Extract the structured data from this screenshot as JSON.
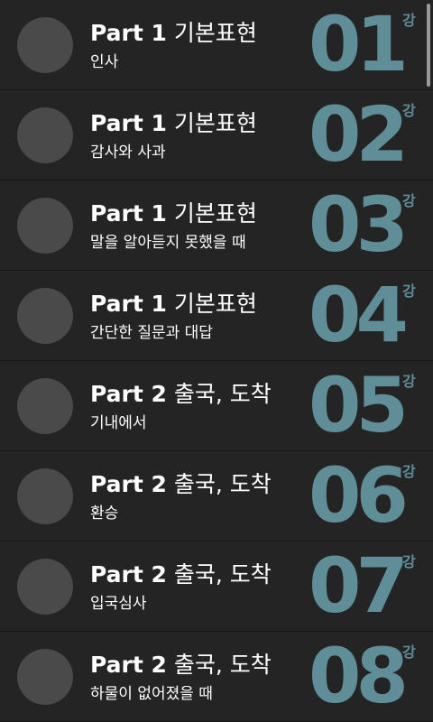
{
  "accent_color": "#5f8e98",
  "lessons": [
    {
      "part": "Part 1",
      "section": "기본표현",
      "subtitle": "인사",
      "number": "01",
      "unit": "강"
    },
    {
      "part": "Part 1",
      "section": "기본표현",
      "subtitle": "감사와 사과",
      "number": "02",
      "unit": "강"
    },
    {
      "part": "Part 1",
      "section": "기본표현",
      "subtitle": "말을 알아듣지 못했을 때",
      "number": "03",
      "unit": "강"
    },
    {
      "part": "Part 1",
      "section": "기본표현",
      "subtitle": "간단한 질문과 대답",
      "number": "04",
      "unit": "강"
    },
    {
      "part": "Part 2",
      "section": "출국, 도착",
      "subtitle": "기내에서",
      "number": "05",
      "unit": "강"
    },
    {
      "part": "Part 2",
      "section": "출국, 도착",
      "subtitle": "환승",
      "number": "06",
      "unit": "강"
    },
    {
      "part": "Part 2",
      "section": "출국, 도착",
      "subtitle": "입국심사",
      "number": "07",
      "unit": "강"
    },
    {
      "part": "Part 2",
      "section": "출국, 도착",
      "subtitle": "하물이 없어졌을 때",
      "number": "08",
      "unit": "강"
    }
  ]
}
